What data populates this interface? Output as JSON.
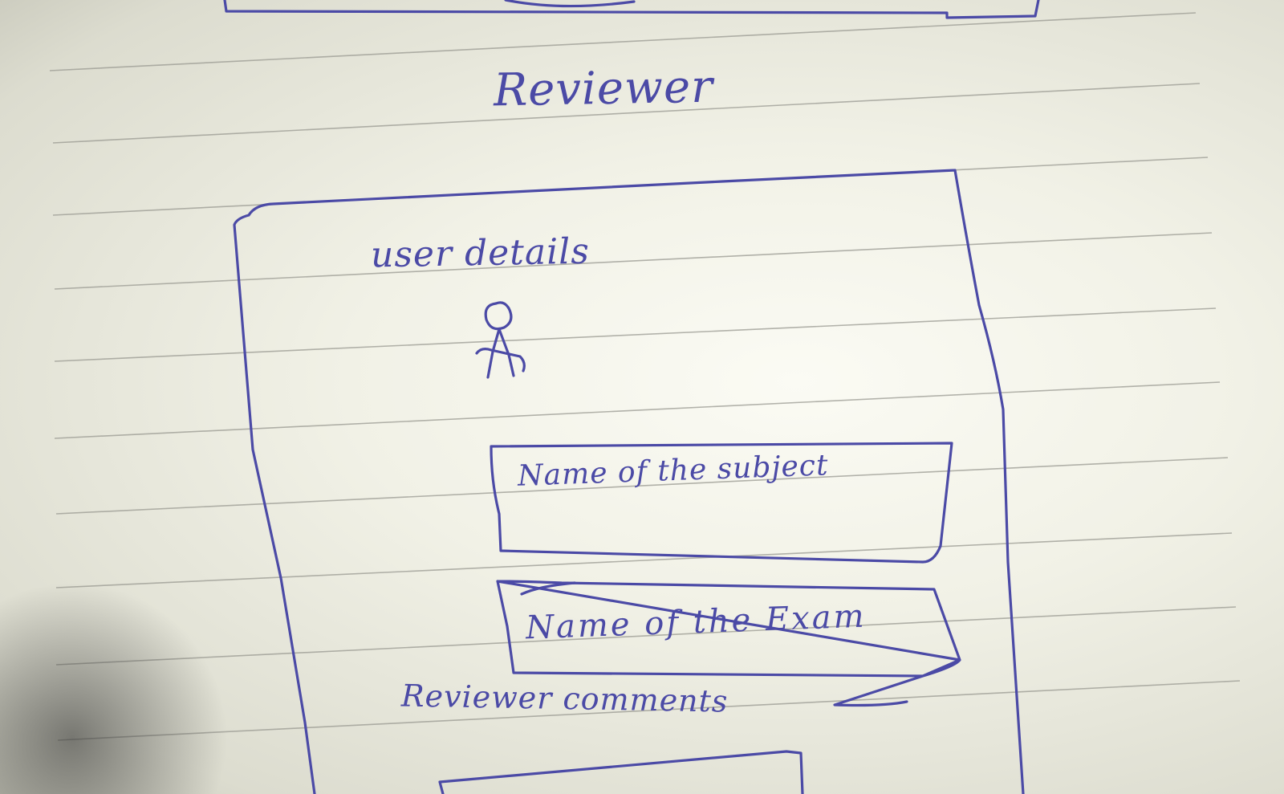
{
  "page": {
    "title": "Reviewer",
    "user_section_label": "user details",
    "user_icon": "person-icon",
    "fields": {
      "subject": "Name of the subject",
      "exam": "Name of the Exam"
    },
    "comments_label": "Reviewer comments"
  },
  "colors": {
    "ink": "#4b4aa6",
    "paper": "#f1f1e6",
    "rule": "#9a9a92"
  }
}
